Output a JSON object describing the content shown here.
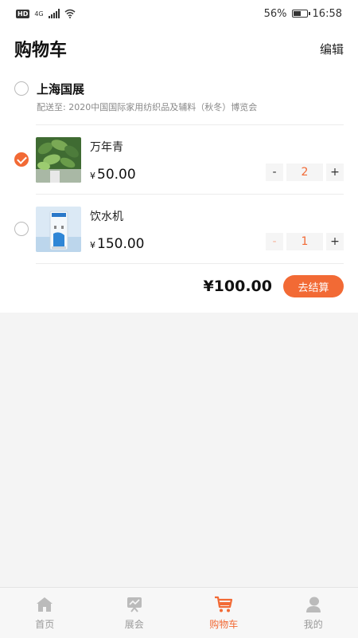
{
  "status_bar": {
    "network": "HD",
    "signal_type": "4G",
    "battery": "56%",
    "time": "16:58"
  },
  "header": {
    "title": "购物车",
    "edit_label": "编辑"
  },
  "store": {
    "name": "上海国展",
    "delivery": "配送至: 2020中国国际家用纺织品及辅料（秋冬）博览会"
  },
  "items": [
    {
      "name": "万年青",
      "currency": "¥",
      "price": "50.00",
      "quantity": "2",
      "selected": true,
      "minus": "-",
      "plus": "+"
    },
    {
      "name": "饮水机",
      "currency": "¥",
      "price": "150.00",
      "quantity": "1",
      "selected": false,
      "minus": "-",
      "plus": "+"
    }
  ],
  "summary": {
    "total": "¥100.00",
    "checkout_label": "去结算"
  },
  "tabs": [
    {
      "label": "首页",
      "icon": "home-icon",
      "active": false
    },
    {
      "label": "展会",
      "icon": "exhibition-icon",
      "active": false
    },
    {
      "label": "购物车",
      "icon": "cart-icon",
      "active": true
    },
    {
      "label": "我的",
      "icon": "profile-icon",
      "active": false
    }
  ],
  "colors": {
    "accent": "#f26a35",
    "inactive_tab": "#bbbbbb"
  }
}
